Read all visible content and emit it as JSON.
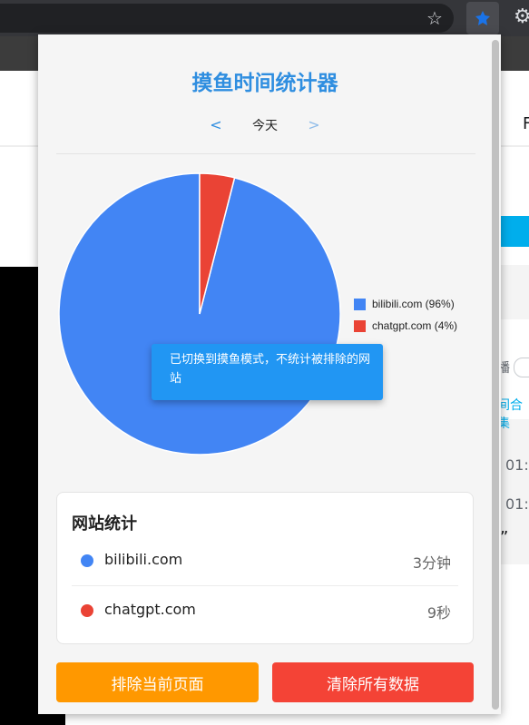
{
  "browser": {
    "star_icon": "☆",
    "gear_icon": "⚙",
    "page_fragments": [
      "F",
      "播",
      "间合集",
      "01:",
      "01:",
      "”"
    ]
  },
  "popup": {
    "title": "摸鱼时间统计器",
    "date_nav": {
      "prev": "<",
      "label": "今天",
      "next": ">"
    },
    "tooltip": "已切换到摸鱼模式，不统计被排除的网站",
    "stats": {
      "title": "网站统计",
      "sites": [
        {
          "name": "bilibili.com",
          "time": "3分钟",
          "color": "#4285f4"
        },
        {
          "name": "chatgpt.com",
          "time": "9秒",
          "color": "#ea4335"
        }
      ]
    },
    "buttons": {
      "exclude": "排除当前页面",
      "clear": "清除所有数据"
    }
  },
  "chart_data": {
    "type": "pie",
    "labels": [
      "bilibili.com",
      "chatgpt.com"
    ],
    "values": [
      96,
      4
    ],
    "unit": "%",
    "colors": [
      "#4285f4",
      "#ea4335"
    ],
    "legend": [
      "bilibili.com (96%)",
      "chatgpt.com (4%)"
    ],
    "legend_position": "right"
  }
}
